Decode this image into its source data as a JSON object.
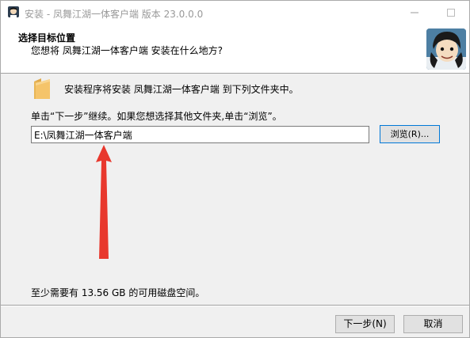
{
  "window": {
    "title": "安装 - 凤舞江湖一体客户端 版本 23.0.0.0",
    "controls": [
      "minimize",
      "maximize",
      "close"
    ]
  },
  "header": {
    "title": "选择目标位置",
    "subtitle": "您想将 凤舞江湖一体客户端 安装在什么地方?"
  },
  "body": {
    "info": "安装程序将安装 凤舞江湖一体客户端 到下列文件夹中。",
    "instructions": "单击“下一步”继续。如果您想选择其他文件夹,单击“浏览”。",
    "install_path": "E:\\凤舞江湖一体客户端",
    "browse_label": "浏览(R)...",
    "space_required": "至少需要有 13.56 GB 的可用磁盘空间。"
  },
  "footer": {
    "next_label": "下一步(N)",
    "cancel_label": "取消"
  },
  "icons": {
    "app": "installer-app-icon",
    "folder": "folder-icon",
    "logo": "game-character-logo",
    "annotation": "red-arrow-icon"
  },
  "colors": {
    "accent": "#0078d7",
    "annotation_arrow": "#e8382d",
    "folder": "#f5c46a"
  }
}
